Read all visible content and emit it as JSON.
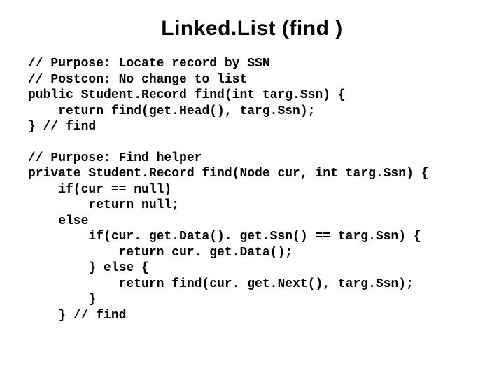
{
  "title": "Linked.List (find )",
  "block1": {
    "l1": "// Purpose: Locate record by SSN",
    "l2": "// Postcon: No change to list",
    "l3": "public Student.Record find(int targ.Ssn) {",
    "l4": "    return find(get.Head(), targ.Ssn);",
    "l5": "} // find"
  },
  "block2": {
    "l1": "// Purpose: Find helper",
    "l2": "private Student.Record find(Node cur, int targ.Ssn) {",
    "l3": "    if(cur == null)",
    "l4": "        return null;",
    "l5": "    else",
    "l6": "        if(cur. get.Data(). get.Ssn() == targ.Ssn) {",
    "l7": "            return cur. get.Data();",
    "l8": "        } else {",
    "l9": "            return find(cur. get.Next(), targ.Ssn);",
    "l10": "        }",
    "l11": "    } // find"
  }
}
